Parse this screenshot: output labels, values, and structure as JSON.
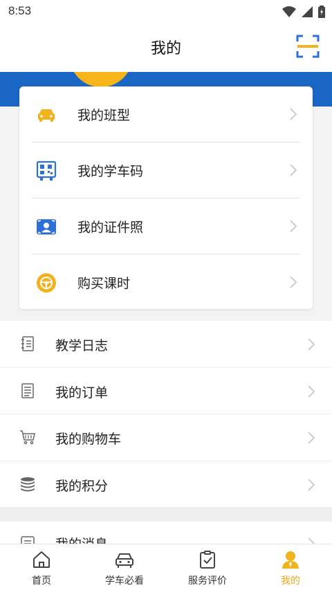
{
  "status_bar": {
    "time": "8:53"
  },
  "header": {
    "title": "我的",
    "scan_icon": "scan-icon"
  },
  "card": {
    "items": [
      {
        "label": "我的班型",
        "icon": "car-icon",
        "color": "#f2b21d"
      },
      {
        "label": "我的学车码",
        "icon": "qrcode-icon",
        "color": "#2f6fd8"
      },
      {
        "label": "我的证件照",
        "icon": "id-photo-icon",
        "color": "#2f6fd8"
      },
      {
        "label": "购买课时",
        "icon": "steering-wheel-icon",
        "color": "#f2b21d"
      }
    ]
  },
  "list": {
    "items": [
      {
        "label": "教学日志",
        "icon": "log-icon"
      },
      {
        "label": "我的订单",
        "icon": "order-icon"
      },
      {
        "label": "我的购物车",
        "icon": "cart-icon"
      },
      {
        "label": "我的积分",
        "icon": "coins-icon"
      }
    ],
    "partial_item": {
      "label": "我的消息",
      "icon": "message-icon"
    }
  },
  "tabs": [
    {
      "label": "首页",
      "icon": "home-icon",
      "active": false
    },
    {
      "label": "学车必看",
      "icon": "car-outline-icon",
      "active": false
    },
    {
      "label": "服务评价",
      "icon": "clipboard-check-icon",
      "active": false
    },
    {
      "label": "我的",
      "icon": "user-icon",
      "active": true
    }
  ],
  "colors": {
    "accent": "#f2a81d",
    "banner": "#1a66c4",
    "blue_icon": "#2f6fd8"
  }
}
